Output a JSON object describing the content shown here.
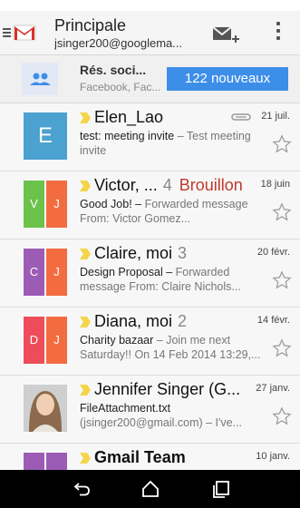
{
  "app": {
    "account_title": "Principale",
    "account_email": "jsinger200@googlema..."
  },
  "social": {
    "title": "Rés. soci...",
    "subtitle": "Facebook, Fac...",
    "badge": "122 nouveaux"
  },
  "emails": [
    {
      "sender": "Elen_Lao",
      "count": "",
      "draft": "",
      "date": "21 juil.",
      "subject": "test: meeting invite",
      "preview": " – Test meeting invite",
      "avatar_type": "letter",
      "avatar_letters": [
        "E"
      ],
      "avatar_colors": [
        "#4ba1cf"
      ],
      "has_attachment": true
    },
    {
      "sender": "Victor, ...",
      "count": "4",
      "draft": "Brouillon",
      "date": "18 juin",
      "subject": "Good Job! –",
      "preview": " Forwarded message From: Victor Gomez...",
      "avatar_type": "split",
      "avatar_letters": [
        "V",
        "J"
      ],
      "avatar_colors": [
        "#6cc24a",
        "#f36c40"
      ],
      "has_attachment": false
    },
    {
      "sender": "Claire, moi",
      "count": "3",
      "draft": "",
      "date": "20 févr.",
      "subject": "Design Proposal –",
      "preview": " Forwarded message From: Claire Nichols...",
      "avatar_type": "split",
      "avatar_letters": [
        "C",
        "J"
      ],
      "avatar_colors": [
        "#9c5bb5",
        "#f36c40"
      ],
      "has_attachment": false
    },
    {
      "sender": "Diana, moi",
      "count": "2",
      "draft": "",
      "date": "14 févr.",
      "subject": "Charity bazaar",
      "preview": " – Join me next Saturday!! On 14 Feb 2014 13:29,...",
      "avatar_type": "split",
      "avatar_letters": [
        "D",
        "J"
      ],
      "avatar_colors": [
        "#ee4c5a",
        "#f36c40"
      ],
      "has_attachment": false
    },
    {
      "sender": "Jennifer Singer (G...",
      "count": "",
      "draft": "",
      "date": "27 janv.",
      "subject": "FileAttachment.txt",
      "preview": " (jsinger200@gmail.com) – I've...",
      "avatar_type": "photo",
      "avatar_letters": [],
      "avatar_colors": [],
      "has_attachment": false
    },
    {
      "sender": "Gmail Team",
      "count": "",
      "draft": "",
      "date": "10 janv.",
      "subject": "",
      "preview": "",
      "avatar_type": "split",
      "avatar_letters": [
        "",
        ""
      ],
      "avatar_colors": [
        "#9c5bb5",
        "#9c5bb5"
      ],
      "has_attachment": false
    }
  ],
  "icons": {
    "compose": "compose-mail-icon",
    "overflow": "overflow-menu-icon",
    "social": "people-icon",
    "star": "star-outline-icon",
    "tag": "importance-marker-icon",
    "attachment": "paperclip-icon",
    "nav_back": "back-icon",
    "nav_home": "home-icon",
    "nav_recent": "recent-apps-icon"
  },
  "colors": {
    "accent": "#3d8ee8",
    "importance_tag": "#f5d547",
    "draft": "#c0392b",
    "gmail_red": "#d93025"
  }
}
